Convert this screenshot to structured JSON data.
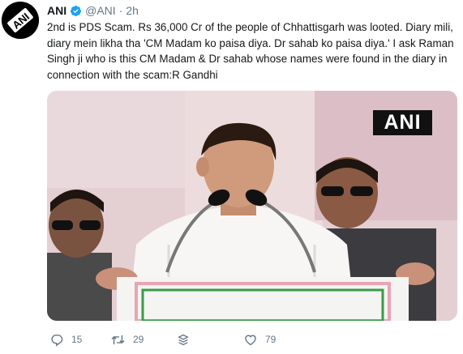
{
  "tweet": {
    "author_name": "ANI",
    "handle": "@ANI",
    "separator": "·",
    "time": "2h",
    "text": "2nd is PDS Scam. Rs 36,000 Cr of the people of Chhattisgarh was looted. Diary mili, diary mein likha tha 'CM Madam ko paisa diya. Dr sahab ko paisa diya.' I ask Raman Singh ji who is this CM Madam & Dr sahab whose names were found in the diary in connection with the scam:R Gandhi",
    "avatar_logo_text": "ANI",
    "media_watermark": "ANI"
  },
  "actions": {
    "reply_count": "15",
    "retweet_count": "29",
    "like_count": "79"
  },
  "icons": {
    "verified": "verified-badge-icon",
    "reply": "reply-icon",
    "retweet": "retweet-icon",
    "stack": "stack-icon",
    "like": "heart-icon"
  },
  "colors": {
    "verified": "#1da1f2",
    "meta_gray": "#657786",
    "text": "#14171a"
  }
}
